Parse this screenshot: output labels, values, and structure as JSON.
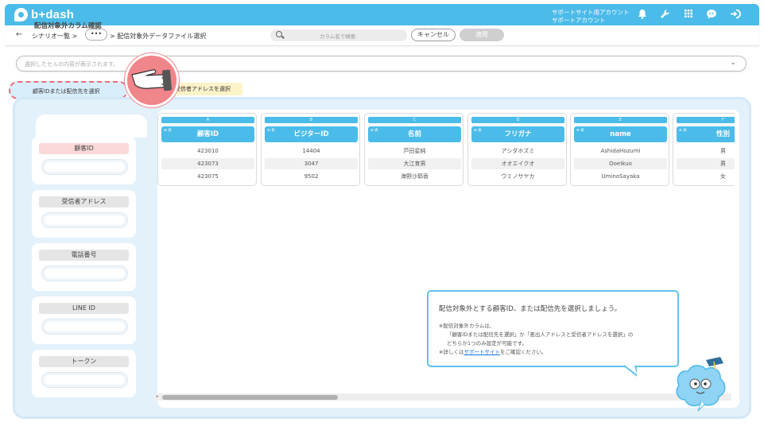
{
  "app": {
    "logo": "b+dash"
  },
  "header": {
    "account_line1": "サポートサイト用アカウント",
    "account_line2": "サポートアカウント",
    "icons": [
      "bell-icon",
      "wrench-icon",
      "grid-icon",
      "chat-icon",
      "logout-icon"
    ]
  },
  "subbar": {
    "back": "←",
    "crumb1": "シナリオ一覧 >",
    "dots": "•••",
    "crumb2": "> 配信対象外データファイル選択",
    "search_placeholder": "カラム名で検索",
    "cancel": "キャンセル",
    "apply": "適用"
  },
  "cell_preview": {
    "placeholder": "選択したセルの内容が表示されます。"
  },
  "tabs": {
    "tab1": "顧客IDまたは配信先を選択",
    "tab2": "受信者アドレスを選択"
  },
  "left_panel": {
    "title": "配信対象外カラム確認",
    "items": [
      {
        "label": "顧客ID"
      },
      {
        "label": "受信者アドレス"
      },
      {
        "label": "電話番号"
      },
      {
        "label": "LINE ID"
      },
      {
        "label": "トークン"
      }
    ]
  },
  "columns": [
    {
      "letter": "A",
      "sub": "⊕ 表",
      "name": "顧客ID",
      "cells": [
        "423010",
        "423073",
        "423075"
      ]
    },
    {
      "letter": "B",
      "sub": "⊕ 表",
      "name": "ビジターID",
      "cells": [
        "14404",
        "3047",
        "9502"
      ]
    },
    {
      "letter": "C",
      "sub": "⊕ 表",
      "name": "名前",
      "cells": [
        "芦田星純",
        "大江育男",
        "海野沙耶香"
      ]
    },
    {
      "letter": "D",
      "sub": "⊕ 表",
      "name": "フリガナ",
      "cells": [
        "アシダホズミ",
        "オオエイクオ",
        "ウミノサヤカ"
      ]
    },
    {
      "letter": "E",
      "sub": "⊕ 表",
      "name": "name",
      "cells": [
        "AshidaHozumi",
        "OoeIkuo",
        "UminoSayaka"
      ]
    },
    {
      "letter": "F",
      "sub": "⊕ 表",
      "name": "性別",
      "cells": [
        "男",
        "男",
        "女"
      ]
    }
  ],
  "tooltip": {
    "title": "配信対象外とする顧客ID、または配信先を選択しましょう。",
    "line1": "※配信対象外カラムは、",
    "line2": "「顧客IDまたは配信先を選択」か「差出人アドレスと受信者アドレスを選択」の",
    "line3": "どちらか1つのみ設定が可能です。",
    "line4_pre": "※詳しくは",
    "line4_link": "サポートサイト",
    "line4_post": "をご確認ください。"
  },
  "colors": {
    "primary": "#4bbbe9",
    "highlight": "#ea6d78",
    "panel": "#e3f1fb"
  }
}
